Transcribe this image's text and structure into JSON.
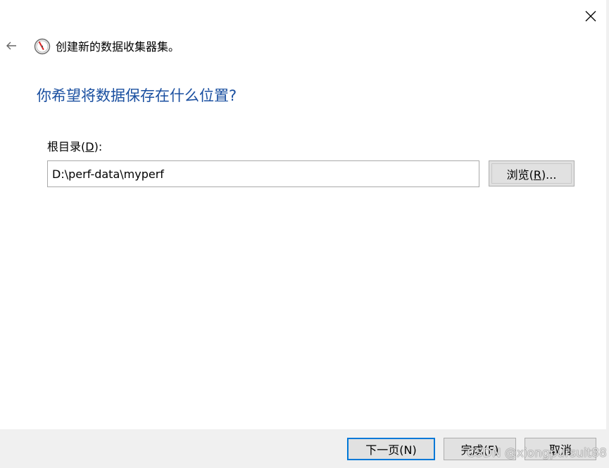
{
  "window": {
    "title": "创建新的数据收集器集。",
    "close_icon": "close-icon",
    "back_icon": "back-arrow-icon",
    "app_icon": "performance-monitor-icon"
  },
  "page": {
    "heading": "你希望将数据保存在什么位置?"
  },
  "root_dir": {
    "label_prefix": "根目录(",
    "label_key": "D",
    "label_suffix": "):",
    "value": "D:\\perf-data\\myperf"
  },
  "browse": {
    "label_prefix": "浏览(",
    "label_key": "R",
    "label_suffix": ")..."
  },
  "footer": {
    "next_label": "下一页(N)",
    "finish_label": "完成(F)",
    "cancel_label": "取消"
  },
  "watermark": "CSDN @xiongpursuit88",
  "colors": {
    "heading": "#1a4fa0",
    "footer_bg": "#f0f0f0",
    "button_bg": "#e1e1e1",
    "focus_border": "#0078d7"
  }
}
